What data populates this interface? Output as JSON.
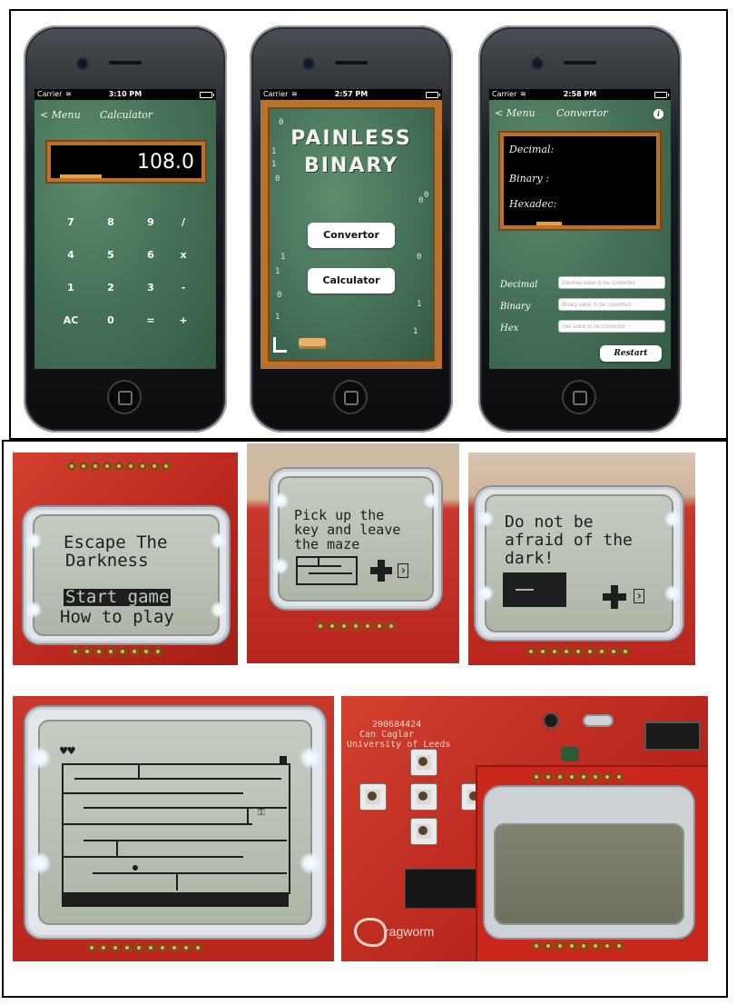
{
  "phones": {
    "calculator": {
      "status": {
        "carrier": "Carrier",
        "time": "3:10 PM"
      },
      "nav": {
        "back": "< Menu",
        "title": "Calculator"
      },
      "display_value": "108.0",
      "keys": [
        [
          "7",
          "8",
          "9",
          "/"
        ],
        [
          "4",
          "5",
          "6",
          "x"
        ],
        [
          "1",
          "2",
          "3",
          "-"
        ],
        [
          "AC",
          "0",
          "=",
          "+"
        ]
      ]
    },
    "menu": {
      "status": {
        "carrier": "Carrier",
        "time": "2:57 PM"
      },
      "title_line1": "PAINLESS",
      "title_line2": "BINARY",
      "buttons": {
        "convertor": "Convertor",
        "calculator": "Calculator"
      }
    },
    "convertor": {
      "status": {
        "carrier": "Carrier",
        "time": "2:58 PM"
      },
      "nav": {
        "back": "< Menu",
        "title": "Convertor",
        "info": "i"
      },
      "board": {
        "decimal": "Decimal:",
        "binary": "Binary :",
        "hexadec": "Hexadec:"
      },
      "fields": [
        {
          "label": "Decimal",
          "placeholder": "Decimal value to be converted"
        },
        {
          "label": "Binary",
          "placeholder": "Binary value to be converted"
        },
        {
          "label": "Hex",
          "placeholder": "Hex value to be converted"
        }
      ],
      "restart": "Restart"
    }
  },
  "lcd_photos": {
    "title_screen": {
      "line1": "Escape The",
      "line2": "Darkness",
      "menu_selected": "Start game",
      "menu_other": "How to play"
    },
    "instructions_1": {
      "line1": "Pick up the",
      "line2": "key and leave",
      "line3": "the maze"
    },
    "instructions_2": {
      "line1": "Do not be",
      "line2": "afraid of the",
      "line3": "dark!"
    }
  },
  "board_photo": {
    "silkscreen_id": "200684424",
    "silkscreen_name": "Can Caglar",
    "silkscreen_uni": "University of Leeds",
    "logo_text": "ragworm"
  }
}
